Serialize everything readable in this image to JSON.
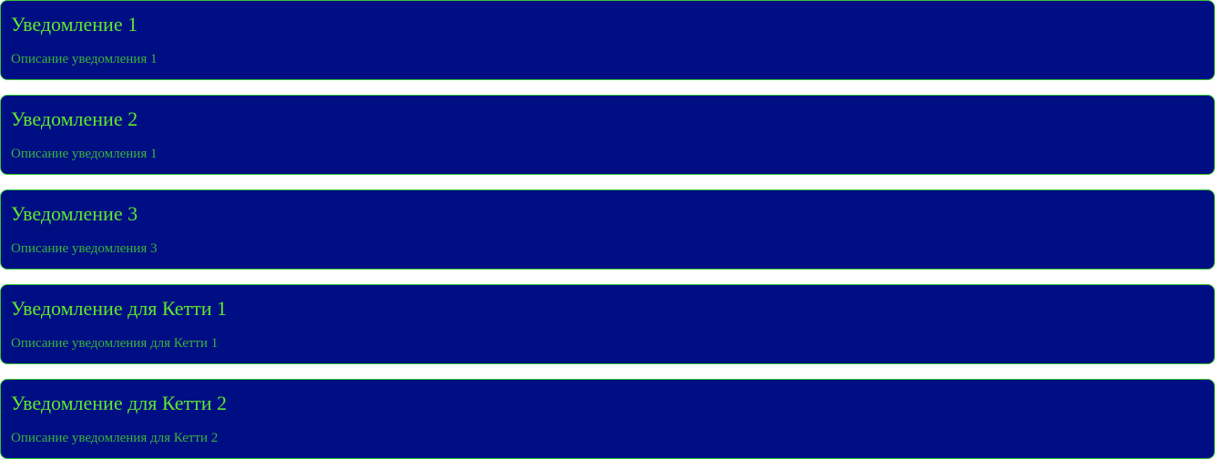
{
  "colors": {
    "page_background": "#ffffff",
    "card_background": "#000e84",
    "card_border": "#33c433",
    "title_text": "#5ee82c",
    "description_text": "#3bb33a"
  },
  "notifications": [
    {
      "title": "Уведомление 1",
      "description": "Описание уведомления 1"
    },
    {
      "title": "Уведомление 2",
      "description": "Описание уведомления 1"
    },
    {
      "title": "Уведомление 3",
      "description": "Описание уведомления 3"
    },
    {
      "title": "Уведомление для Кетти 1",
      "description": "Описание уведомления для Кетти 1"
    },
    {
      "title": "Уведомление для Кетти 2",
      "description": "Описание уведомления для Кетти 2"
    }
  ]
}
